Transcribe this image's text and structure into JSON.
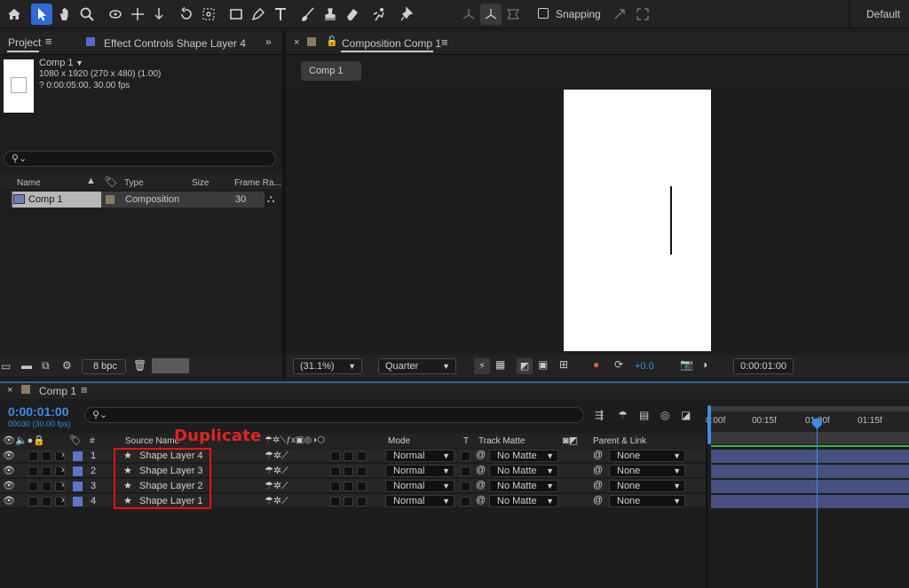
{
  "workspace": {
    "snapping_label": "Snapping",
    "workspace_name": "Default"
  },
  "project": {
    "tab_label": "Project",
    "effect_controls_label": "Effect Controls Shape Layer 4",
    "selected_item": {
      "name": "Comp 1",
      "dimensions": "1080 x 1920  (270 x 480) (1.00)",
      "duration": "? 0:00:05:00, 30.00 fps"
    },
    "columns": [
      "Name",
      "Type",
      "Size",
      "Frame Ra..."
    ],
    "rows": [
      {
        "name": "Comp 1",
        "type": "Composition",
        "frame_rate": "30"
      }
    ],
    "bpc": "8 bpc"
  },
  "composition": {
    "tab_label": "Composition Comp 1",
    "sub_tab": "Comp 1",
    "zoom": "(31.1%)",
    "resolution": "Quarter",
    "exposure": "+0.0",
    "current_time": "0:00:01:00"
  },
  "timeline": {
    "tab_label": "Comp 1",
    "timecode": "0:00:01:00",
    "fps_label": "00030 (30.00 fps)",
    "headers": {
      "number": "#",
      "source_name": "Source Name",
      "mode": "Mode",
      "t": "T",
      "track_matte": "Track Matte",
      "parent": "Parent & Link"
    },
    "layers": [
      {
        "num": "1",
        "name": "Shape Layer 4",
        "mode": "Normal",
        "matte": "No Matte",
        "parent": "None"
      },
      {
        "num": "2",
        "name": "Shape Layer 3",
        "mode": "Normal",
        "matte": "No Matte",
        "parent": "None"
      },
      {
        "num": "3",
        "name": "Shape Layer 2",
        "mode": "Normal",
        "matte": "No Matte",
        "parent": "None"
      },
      {
        "num": "4",
        "name": "Shape Layer 1",
        "mode": "Normal",
        "matte": "No Matte",
        "parent": "None"
      }
    ],
    "ruler_labels": [
      "0:00f",
      "00:15f",
      "01:00f",
      "01:15f"
    ],
    "annotation": "Duplicate"
  },
  "colors": {
    "accent": "#3d8de6",
    "label": "#6172c9",
    "layer_bar": "#47507e",
    "annotation": "#e42323"
  }
}
